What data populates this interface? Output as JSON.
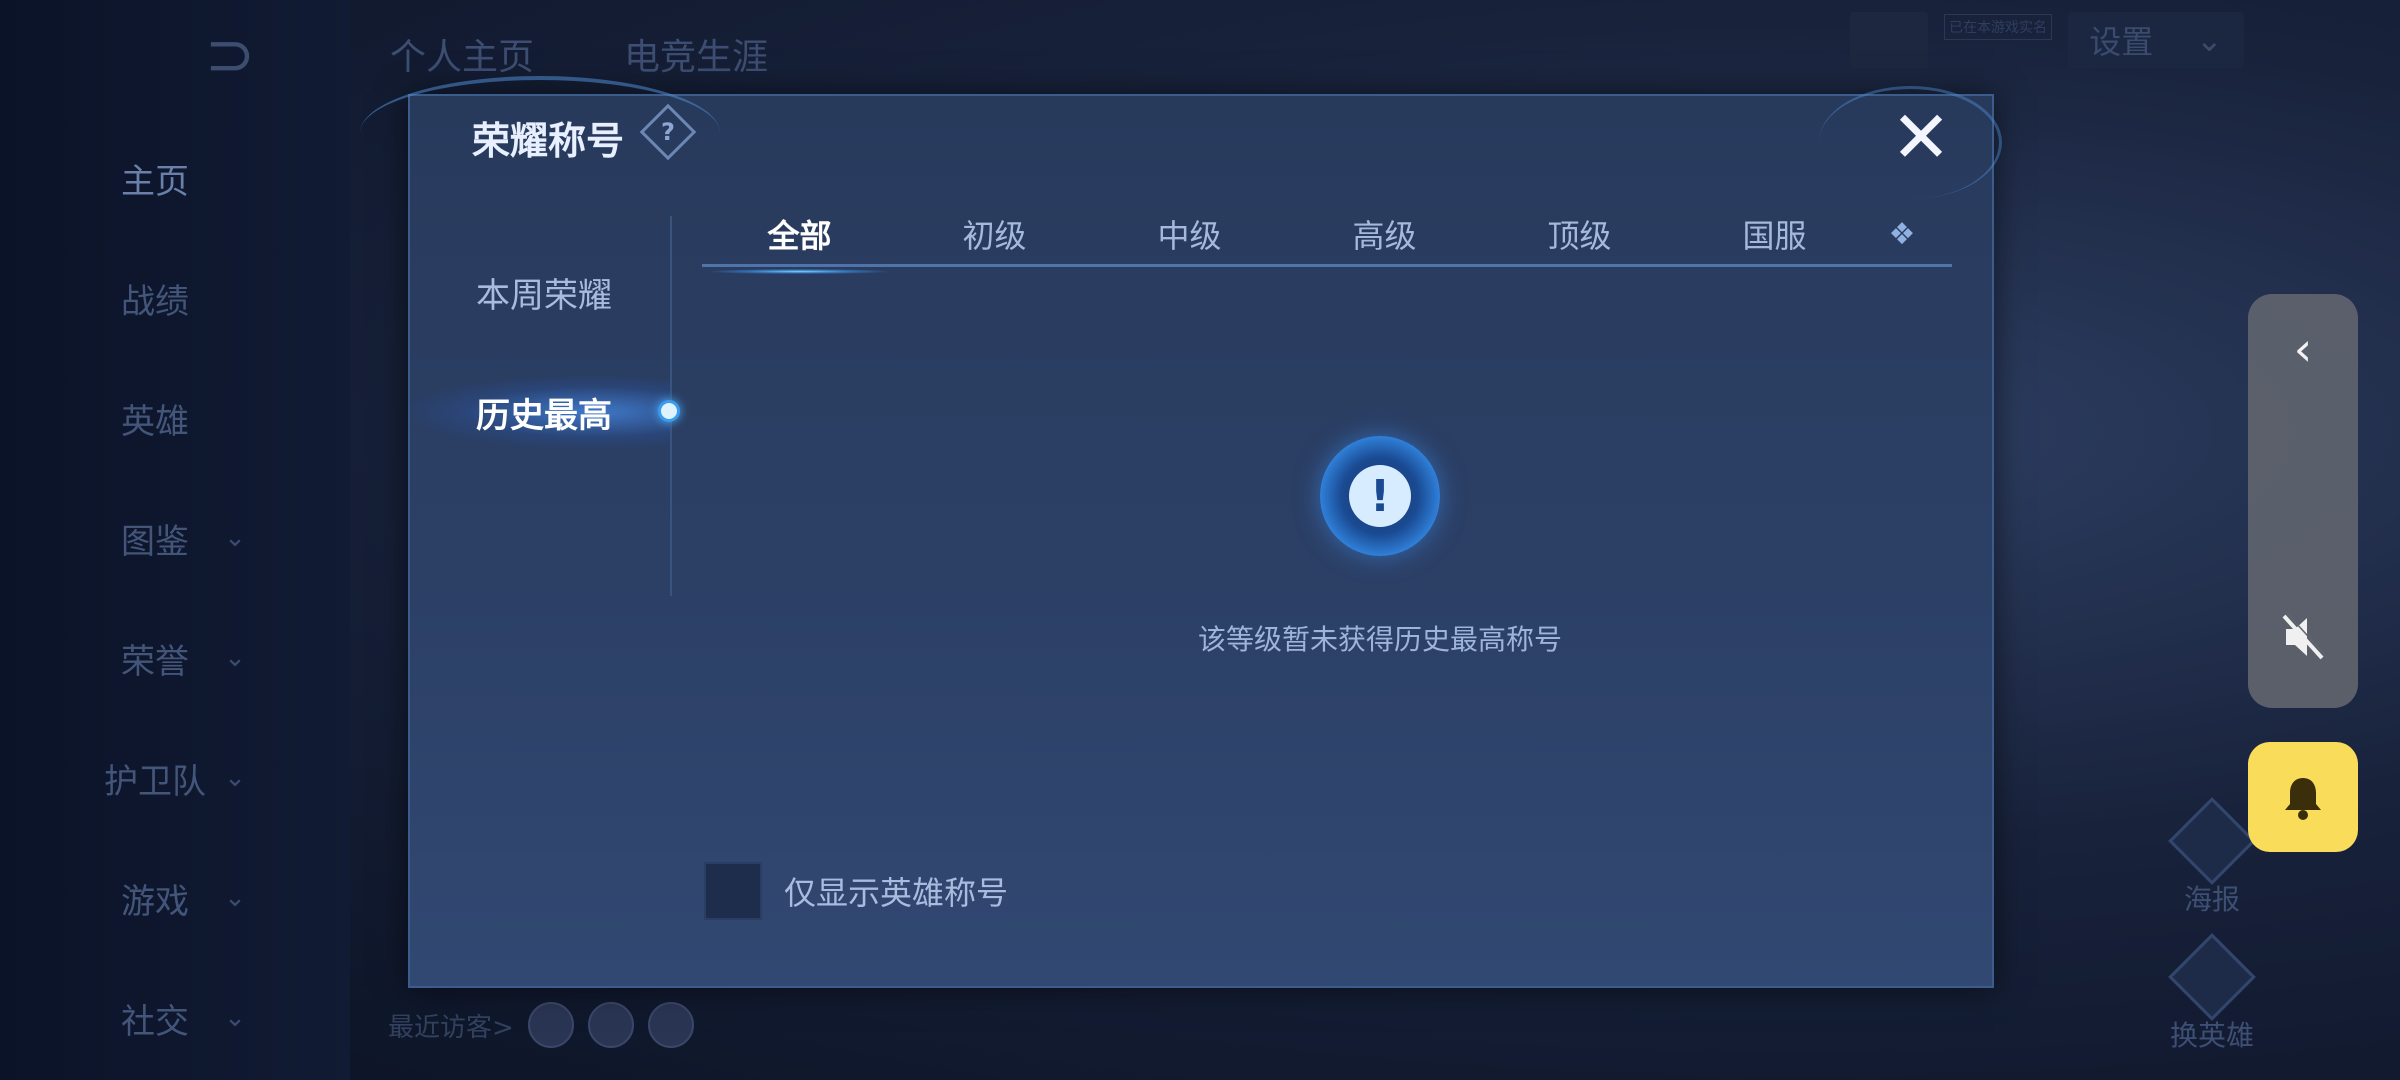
{
  "background": {
    "back_glyph": "⊃",
    "nav_items": [
      {
        "label": "主页",
        "chevron": ""
      },
      {
        "label": "战绩",
        "chevron": ""
      },
      {
        "label": "英雄",
        "chevron": ""
      },
      {
        "label": "图鉴",
        "chevron": "⌄"
      },
      {
        "label": "荣誉",
        "chevron": "⌄"
      },
      {
        "label": "护卫队",
        "chevron": "⌄"
      },
      {
        "label": "游戏",
        "chevron": "⌄"
      },
      {
        "label": "社交",
        "chevron": "⌄"
      }
    ],
    "tabs": [
      "个人主页",
      "电竞生涯"
    ],
    "status_tag": "已在本游戏实名",
    "settings_label": "设置",
    "settings_chevron": "⌄",
    "visitors_label": "最近访客>",
    "right_buttons": [
      "海报",
      "换英雄"
    ]
  },
  "dialog": {
    "title": "荣耀称号",
    "help_glyph": "?",
    "close_glyph": "✕",
    "side_items": [
      {
        "label": "本周荣耀"
      },
      {
        "label": "历史最高"
      }
    ],
    "tabs": [
      {
        "label": "全部"
      },
      {
        "label": "初级"
      },
      {
        "label": "中级"
      },
      {
        "label": "高级"
      },
      {
        "label": "顶级"
      },
      {
        "label": "国服"
      }
    ],
    "tab_more_glyph": "❖",
    "empty_glyph": "!",
    "empty_message": "该等级暂未获得历史最高称号",
    "hero_only_label": "仅显示英雄称号"
  },
  "overlay": {
    "back_glyph": "‹"
  },
  "colors": {
    "accent": "#3a9cf0",
    "notify_bg": "#f9dd5a",
    "dialog_bg": "#2c4066"
  }
}
